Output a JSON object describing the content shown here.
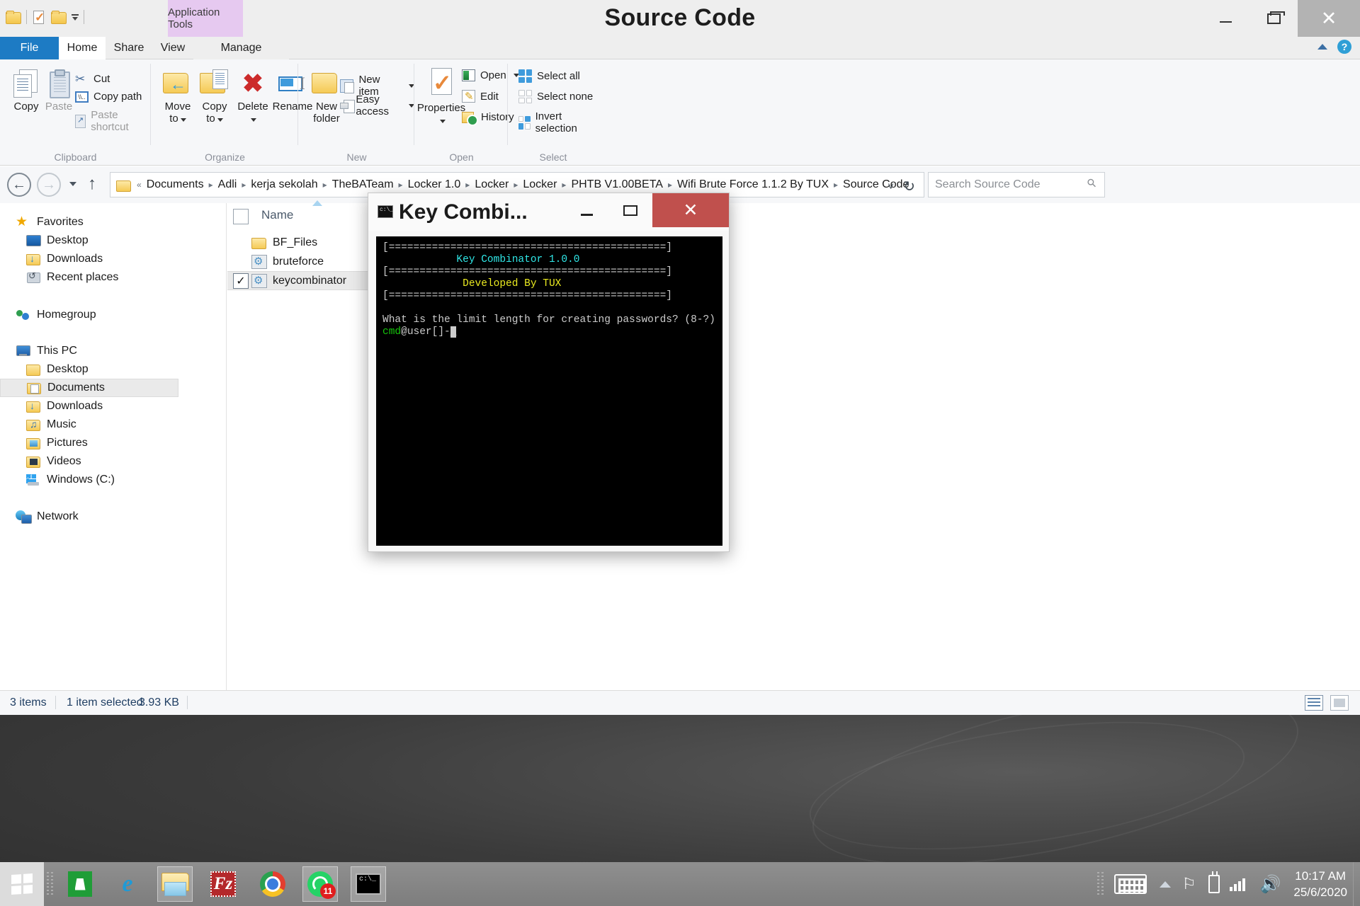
{
  "window": {
    "title": "Source Code",
    "contextual_tab": "Application Tools",
    "minimize": "–",
    "restore": "❐",
    "close": "✕"
  },
  "quick_access": {
    "folder_icon": "folder-icon",
    "properties_icon": "properties-icon",
    "new_folder_icon": "new-folder-icon",
    "customize_icon": "customize-dropdown-icon"
  },
  "ribbon": {
    "tabs": [
      {
        "label": "File",
        "id": "file"
      },
      {
        "label": "Home",
        "id": "home"
      },
      {
        "label": "Share",
        "id": "share"
      },
      {
        "label": "View",
        "id": "view"
      },
      {
        "label": "Manage",
        "id": "manage"
      }
    ],
    "help_icon": "help-icon",
    "collapse_icon": "chevron-up-icon",
    "groups": {
      "clipboard": {
        "label": "Clipboard",
        "copy": "Copy",
        "paste": "Paste",
        "cut": "Cut",
        "copy_path": "Copy path",
        "paste_shortcut": "Paste shortcut"
      },
      "organize": {
        "label": "Organize",
        "move_to": "Move\nto",
        "move_to_line1": "Move",
        "move_to_line2": "to",
        "copy_to_line1": "Copy",
        "copy_to_line2": "to",
        "delete": "Delete",
        "rename": "Rename"
      },
      "new": {
        "label": "New",
        "new_folder_line1": "New",
        "new_folder_line2": "folder",
        "new_item": "New item",
        "easy_access": "Easy access"
      },
      "open": {
        "label": "Open",
        "properties": "Properties",
        "open": "Open",
        "edit": "Edit",
        "history": "History"
      },
      "select": {
        "label": "Select",
        "select_all": "Select all",
        "select_none": "Select none",
        "invert_selection": "Invert selection"
      }
    }
  },
  "address_bar": {
    "back_icon": "back-arrow-icon",
    "forward_icon": "forward-arrow-icon",
    "recent_icon": "recent-locations-icon",
    "up_icon": "up-arrow-icon",
    "overflow": "«",
    "crumbs": [
      "Documents",
      "Adli",
      "kerja sekolah",
      "TheBATeam",
      "Locker 1.0",
      "Locker",
      "Locker",
      "PHTB V1.00BETA",
      "Wifi Brute Force 1.1.2 By TUX",
      "Source Code"
    ],
    "separator": "▸",
    "dropdown_icon": "chevron-down-icon",
    "refresh_icon": "refresh-icon",
    "search_placeholder": "Search Source Code",
    "search_value": "",
    "search_icon": "search-icon"
  },
  "sidebar": {
    "groups": [
      {
        "header": {
          "label": "Favorites",
          "icon": "star-icon"
        },
        "items": [
          {
            "label": "Desktop",
            "icon": "desktop-icon"
          },
          {
            "label": "Downloads",
            "icon": "downloads-folder-icon"
          },
          {
            "label": "Recent places",
            "icon": "recent-places-icon"
          }
        ]
      },
      {
        "header": {
          "label": "Homegroup",
          "icon": "homegroup-icon"
        },
        "items": []
      },
      {
        "header": {
          "label": "This PC",
          "icon": "this-pc-icon"
        },
        "items": [
          {
            "label": "Desktop",
            "icon": "desktop-folder-icon"
          },
          {
            "label": "Documents",
            "icon": "documents-folder-icon",
            "selected": true
          },
          {
            "label": "Downloads",
            "icon": "downloads-folder-icon"
          },
          {
            "label": "Music",
            "icon": "music-folder-icon"
          },
          {
            "label": "Pictures",
            "icon": "pictures-folder-icon"
          },
          {
            "label": "Videos",
            "icon": "videos-folder-icon"
          },
          {
            "label": "Windows (C:)",
            "icon": "windows-drive-icon"
          }
        ]
      },
      {
        "header": {
          "label": "Network",
          "icon": "network-icon"
        },
        "items": []
      }
    ]
  },
  "file_list": {
    "column_header": "Name",
    "sort_indicator": "ascending",
    "rows": [
      {
        "name": "BF_Files",
        "icon": "folder-icon",
        "checked": false
      },
      {
        "name": "bruteforce",
        "icon": "batch-file-icon",
        "checked": false
      },
      {
        "name": "keycombinator",
        "icon": "batch-file-icon",
        "checked": true,
        "selected": true
      }
    ]
  },
  "console": {
    "title": "Key Combi...",
    "icon": "console-icon",
    "minimize": "–",
    "maximize": "❐",
    "close": "✕",
    "close_color": "#c0504d",
    "lines": {
      "rule1": "[=============================================]",
      "app_title": "            Key Combinator 1.0.0",
      "rule2": "[=============================================]",
      "developer": "             Developed By TUX",
      "rule3": "[=============================================]",
      "blank": "",
      "question": "What is the limit length for creating passwords? (8-?)",
      "prompt_user": "cmd",
      "prompt_at": "@",
      "prompt_host": "user[]-"
    },
    "colors": {
      "app_title": "#2fe6e6",
      "developer": "#eaea20",
      "prompt": "#16c60c",
      "text": "#cccccc",
      "background": "#000000"
    }
  },
  "status_bar": {
    "item_count": "3 items",
    "selection": "1 item selected",
    "size": "3.93 KB",
    "details_view_icon": "details-view-icon",
    "icons_view_icon": "large-icons-view-icon"
  },
  "taskbar": {
    "start_icon": "windows-start-icon",
    "apps": [
      {
        "name": "store-icon",
        "label": "Store"
      },
      {
        "name": "internet-explorer-icon",
        "label": "Internet Explorer"
      },
      {
        "name": "file-explorer-icon",
        "label": "File Explorer",
        "active": true
      },
      {
        "name": "filezilla-icon",
        "label": "FileZilla"
      },
      {
        "name": "chrome-icon",
        "label": "Google Chrome"
      },
      {
        "name": "whatsapp-icon",
        "label": "WhatsApp",
        "badge": "11",
        "active": true
      },
      {
        "name": "cmd-icon",
        "label": "Command Prompt",
        "active": true
      }
    ],
    "tray": {
      "keyboard_icon": "touch-keyboard-icon",
      "show_hidden_icon": "show-hidden-icons-icon",
      "flag_icon": "action-center-flag-icon",
      "battery_icon": "battery-icon",
      "network_icon": "network-signal-icon",
      "volume_icon": "volume-icon",
      "time": "10:17 AM",
      "date": "25/6/2020"
    }
  }
}
